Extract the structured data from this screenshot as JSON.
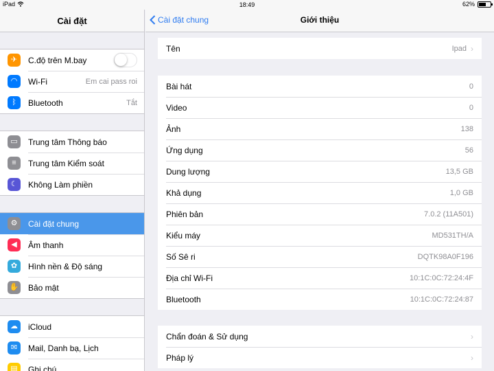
{
  "status_bar": {
    "device": "iPad",
    "time": "18:49",
    "battery_text": "62%",
    "battery_level": 0.62
  },
  "sidebar": {
    "title": "Cài đặt",
    "groups": [
      [
        {
          "label": "C.độ trên M.bay",
          "icon": "airplane-icon",
          "color": "#ff9500",
          "toggle": false
        },
        {
          "label": "Wi-Fi",
          "value": "Em cai pass roi",
          "icon": "wifi-icon",
          "color": "#007aff"
        },
        {
          "label": "Bluetooth",
          "value": "Tắt",
          "icon": "bluetooth-icon",
          "color": "#007aff"
        }
      ],
      [
        {
          "label": "Trung tâm Thông báo",
          "icon": "notification-center-icon",
          "color": "#8e8e93"
        },
        {
          "label": "Trung tâm Kiểm soát",
          "icon": "control-center-icon",
          "color": "#8e8e93"
        },
        {
          "label": "Không Làm phiền",
          "icon": "moon-icon",
          "color": "#5856d6"
        }
      ],
      [
        {
          "label": "Cài đặt chung",
          "icon": "gear-icon",
          "color": "#8e8e93",
          "selected": true
        },
        {
          "label": "Âm thanh",
          "icon": "speaker-icon",
          "color": "#ff2d55"
        },
        {
          "label": "Hình nền & Độ sáng",
          "icon": "flower-icon",
          "color": "#34aadc"
        },
        {
          "label": "Bảo mật",
          "icon": "hand-icon",
          "color": "#8e8e93"
        }
      ],
      [
        {
          "label": "iCloud",
          "icon": "cloud-icon",
          "color": "#1e8cf0"
        },
        {
          "label": "Mail, Danh bạ, Lịch",
          "icon": "mail-icon",
          "color": "#1e8cf0"
        },
        {
          "label": "Ghi chú",
          "icon": "notes-icon",
          "color": "#ffcc00"
        }
      ]
    ]
  },
  "main": {
    "back_label": "Cài đặt chung",
    "title": "Giới thiệu",
    "name_row": {
      "label": "Tên",
      "value": "Ipad"
    },
    "info_rows": [
      {
        "label": "Bài hát",
        "value": "0"
      },
      {
        "label": "Video",
        "value": "0"
      },
      {
        "label": "Ảnh",
        "value": "138"
      },
      {
        "label": "Ứng dụng",
        "value": "56"
      },
      {
        "label": "Dung lượng",
        "value": "13,5 GB"
      },
      {
        "label": "Khả dụng",
        "value": "1,0 GB"
      },
      {
        "label": "Phiên bản",
        "value": "7.0.2 (11A501)"
      },
      {
        "label": "Kiểu máy",
        "value": "MD531TH/A"
      },
      {
        "label": "Số Sê ri",
        "value": "DQTK98A0F196"
      },
      {
        "label": "Địa chỉ Wi-Fi",
        "value": "10:1C:0C:72:24:4F"
      },
      {
        "label": "Bluetooth",
        "value": "10:1C:0C:72:24:87"
      }
    ],
    "bottom_rows": [
      {
        "label": "Chẩn đoán & Sử dụng"
      },
      {
        "label": "Pháp lý"
      }
    ]
  }
}
